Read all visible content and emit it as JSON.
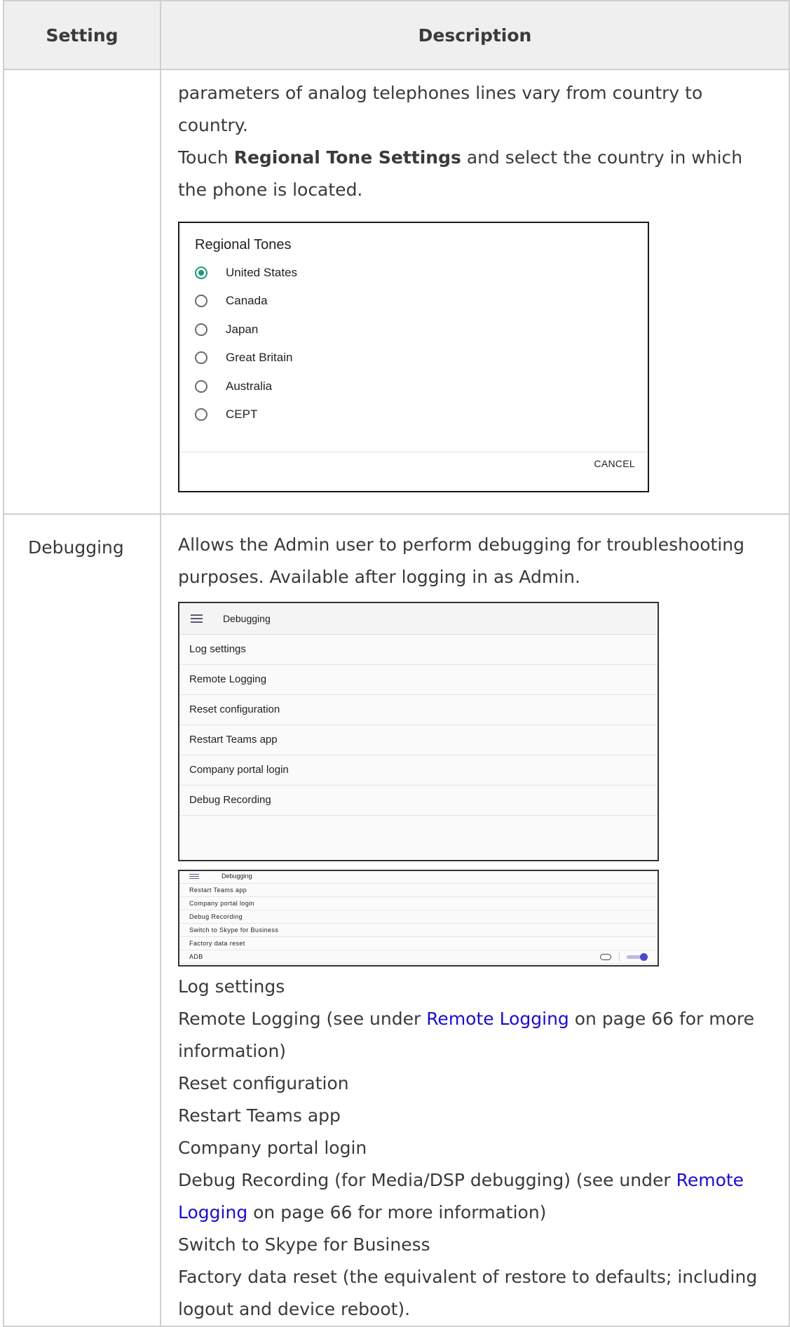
{
  "table": {
    "header": {
      "setting": "Setting",
      "description": "Description"
    }
  },
  "row1": {
    "setting": "",
    "line1": "parameters of analog telephones lines vary from country to country.",
    "line2_pre": "Touch ",
    "line2_bold": "Regional Tone Settings",
    "line2_post": " and select the country in which the phone is located.",
    "dialog": {
      "title": "Regional Tones",
      "options": [
        {
          "label": "United States",
          "selected": true
        },
        {
          "label": "Canada",
          "selected": false
        },
        {
          "label": "Japan",
          "selected": false
        },
        {
          "label": "Great Britain",
          "selected": false
        },
        {
          "label": "Australia",
          "selected": false
        },
        {
          "label": "CEPT",
          "selected": false
        }
      ],
      "cancel": "CANCEL"
    }
  },
  "row2": {
    "setting": "Debugging",
    "intro": "Allows the Admin user to perform debugging for troubleshooting purposes. Available after logging in as Admin.",
    "screen1": {
      "title": "Debugging",
      "items": [
        "Log settings",
        "Remote Logging",
        "Reset configuration",
        "Restart Teams app",
        "Company portal login",
        "Debug Recording"
      ]
    },
    "screen2": {
      "title": "Debugging",
      "items": [
        "Restart Teams app",
        "Company portal login",
        "Debug Recording",
        "Switch to Skype for Business",
        "Factory data reset",
        "ADB"
      ]
    },
    "items": {
      "log_settings": "Log settings",
      "remote_logging_pre": "Remote Logging (see under ",
      "remote_logging_link": "Remote Logging",
      "remote_logging_post": " on page 66 for more information)",
      "reset_configuration": "Reset configuration",
      "restart_teams": "Restart Teams app",
      "company_portal": "Company portal login",
      "debug_recording_pre": "Debug Recording (for Media/DSP debugging) (see under ",
      "debug_recording_link": "Remote Logging",
      "debug_recording_post": " on page 66 for more information)",
      "switch_skype": "Switch to Skype for Business",
      "factory_reset": "Factory data reset (the equivalent of restore to defaults; including logout and device reboot)."
    }
  }
}
